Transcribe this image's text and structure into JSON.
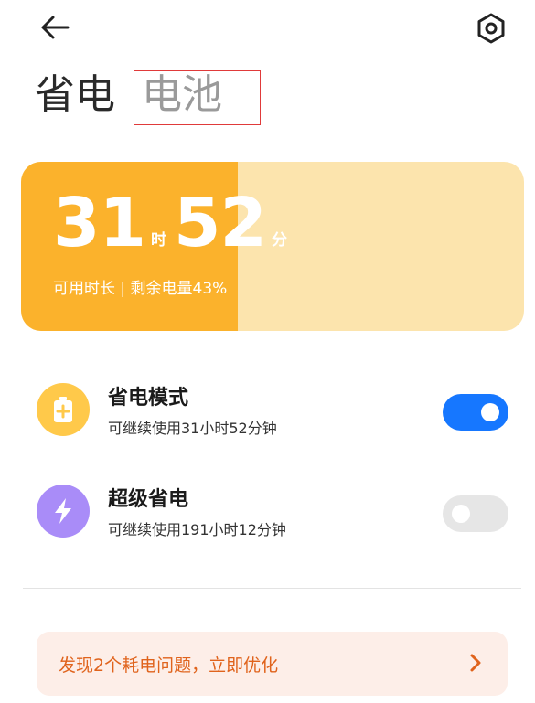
{
  "header": {
    "back_icon": "arrow-left-icon",
    "settings_icon": "gear-icon"
  },
  "tabs": [
    {
      "label": "省电",
      "active": true
    },
    {
      "label": "电池",
      "active": false
    }
  ],
  "battery_card": {
    "hours": "31",
    "hours_unit": "时",
    "minutes": "52",
    "minutes_unit": "分",
    "subtitle": "可用时长 | 剩余电量43%",
    "remaining_percent": 43
  },
  "modes": [
    {
      "title": "省电模式",
      "desc": "可继续使用31小时52分钟",
      "icon": "battery-plus-icon",
      "enabled": true
    },
    {
      "title": "超级省电",
      "desc": "可继续使用191小时12分钟",
      "icon": "lightning-icon",
      "enabled": false
    }
  ],
  "optimize": {
    "text": "发现2个耗电问题，立即优化",
    "icon": "chevron-right-icon"
  },
  "colors": {
    "battery_fill": "#fbb22c",
    "battery_track": "#fce4ad",
    "toggle_on": "#1677ff",
    "toggle_off": "#e6e6e6",
    "mode1_icon_bg": "#ffc94a",
    "mode2_icon_bg": "#a98cf8",
    "highlight_border": "#e03a3a",
    "optimize_text": "#e0631c",
    "optimize_bg": "#fdeee8"
  }
}
